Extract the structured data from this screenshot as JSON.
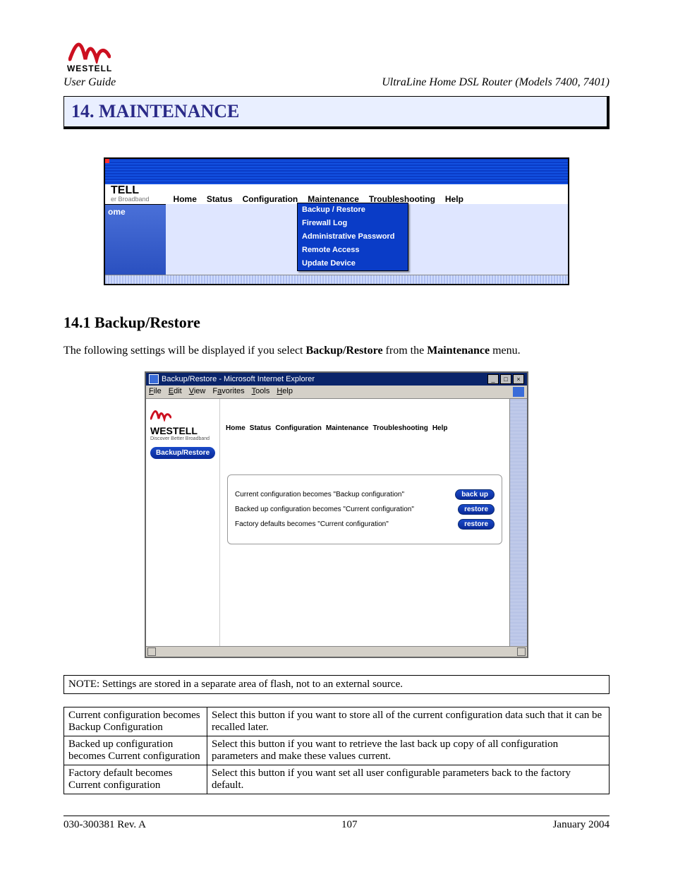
{
  "header": {
    "brand": "WESTELL",
    "guide": "User Guide",
    "product": "UltraLine Home DSL Router (Models 7400, 7401)"
  },
  "section": {
    "title": "14.  MAINTENANCE"
  },
  "fig1": {
    "logo_fragment": "TELL",
    "logo_sub": "er Broadband",
    "nav": [
      "Home",
      "Status",
      "Configuration",
      "Maintenance",
      "Troubleshooting",
      "Help"
    ],
    "side_label": "ome",
    "dropdown": [
      "Backup / Restore",
      "Firewall Log",
      "Administrative Password",
      "Remote Access",
      "Update Device"
    ]
  },
  "subsection": {
    "title": "14.1 Backup/Restore"
  },
  "intro": {
    "pre": "The following settings will be displayed if you select ",
    "b1": "Backup/Restore",
    "mid": " from the ",
    "b2": "Maintenance",
    "post": " menu."
  },
  "fig2": {
    "window_title": "Backup/Restore - Microsoft Internet Explorer",
    "menubar": [
      "File",
      "Edit",
      "View",
      "Favorites",
      "Tools",
      "Help"
    ],
    "brand": "WESTELL",
    "tag": "Discover Better Broadband",
    "pill": "Backup/Restore",
    "nav": [
      "Home",
      "Status",
      "Configuration",
      "Maintenance",
      "Troubleshooting",
      "Help"
    ],
    "rows": [
      {
        "label": "Current configuration becomes \"Backup configuration\"",
        "btn": "back up"
      },
      {
        "label": "Backed up configuration becomes \"Current configuration\"",
        "btn": "restore"
      },
      {
        "label": "Factory defaults becomes \"Current configuration\"",
        "btn": "restore"
      }
    ]
  },
  "note": "NOTE: Settings are stored in a separate area of flash, not to an external source.",
  "table": [
    {
      "k": "Current configuration becomes Backup Configuration",
      "v": "Select this button if you want to store all of the current configuration data such that it can be recalled later."
    },
    {
      "k": "Backed up configuration becomes Current configuration",
      "v": "Select this button if you want to retrieve the last back up copy of all configuration parameters and make these values current."
    },
    {
      "k": "Factory default becomes Current configuration",
      "v": "Select this button if you want set all user configurable parameters back to the factory default."
    }
  ],
  "footer": {
    "left": "030-300381 Rev. A",
    "center": "107",
    "right": "January 2004"
  }
}
